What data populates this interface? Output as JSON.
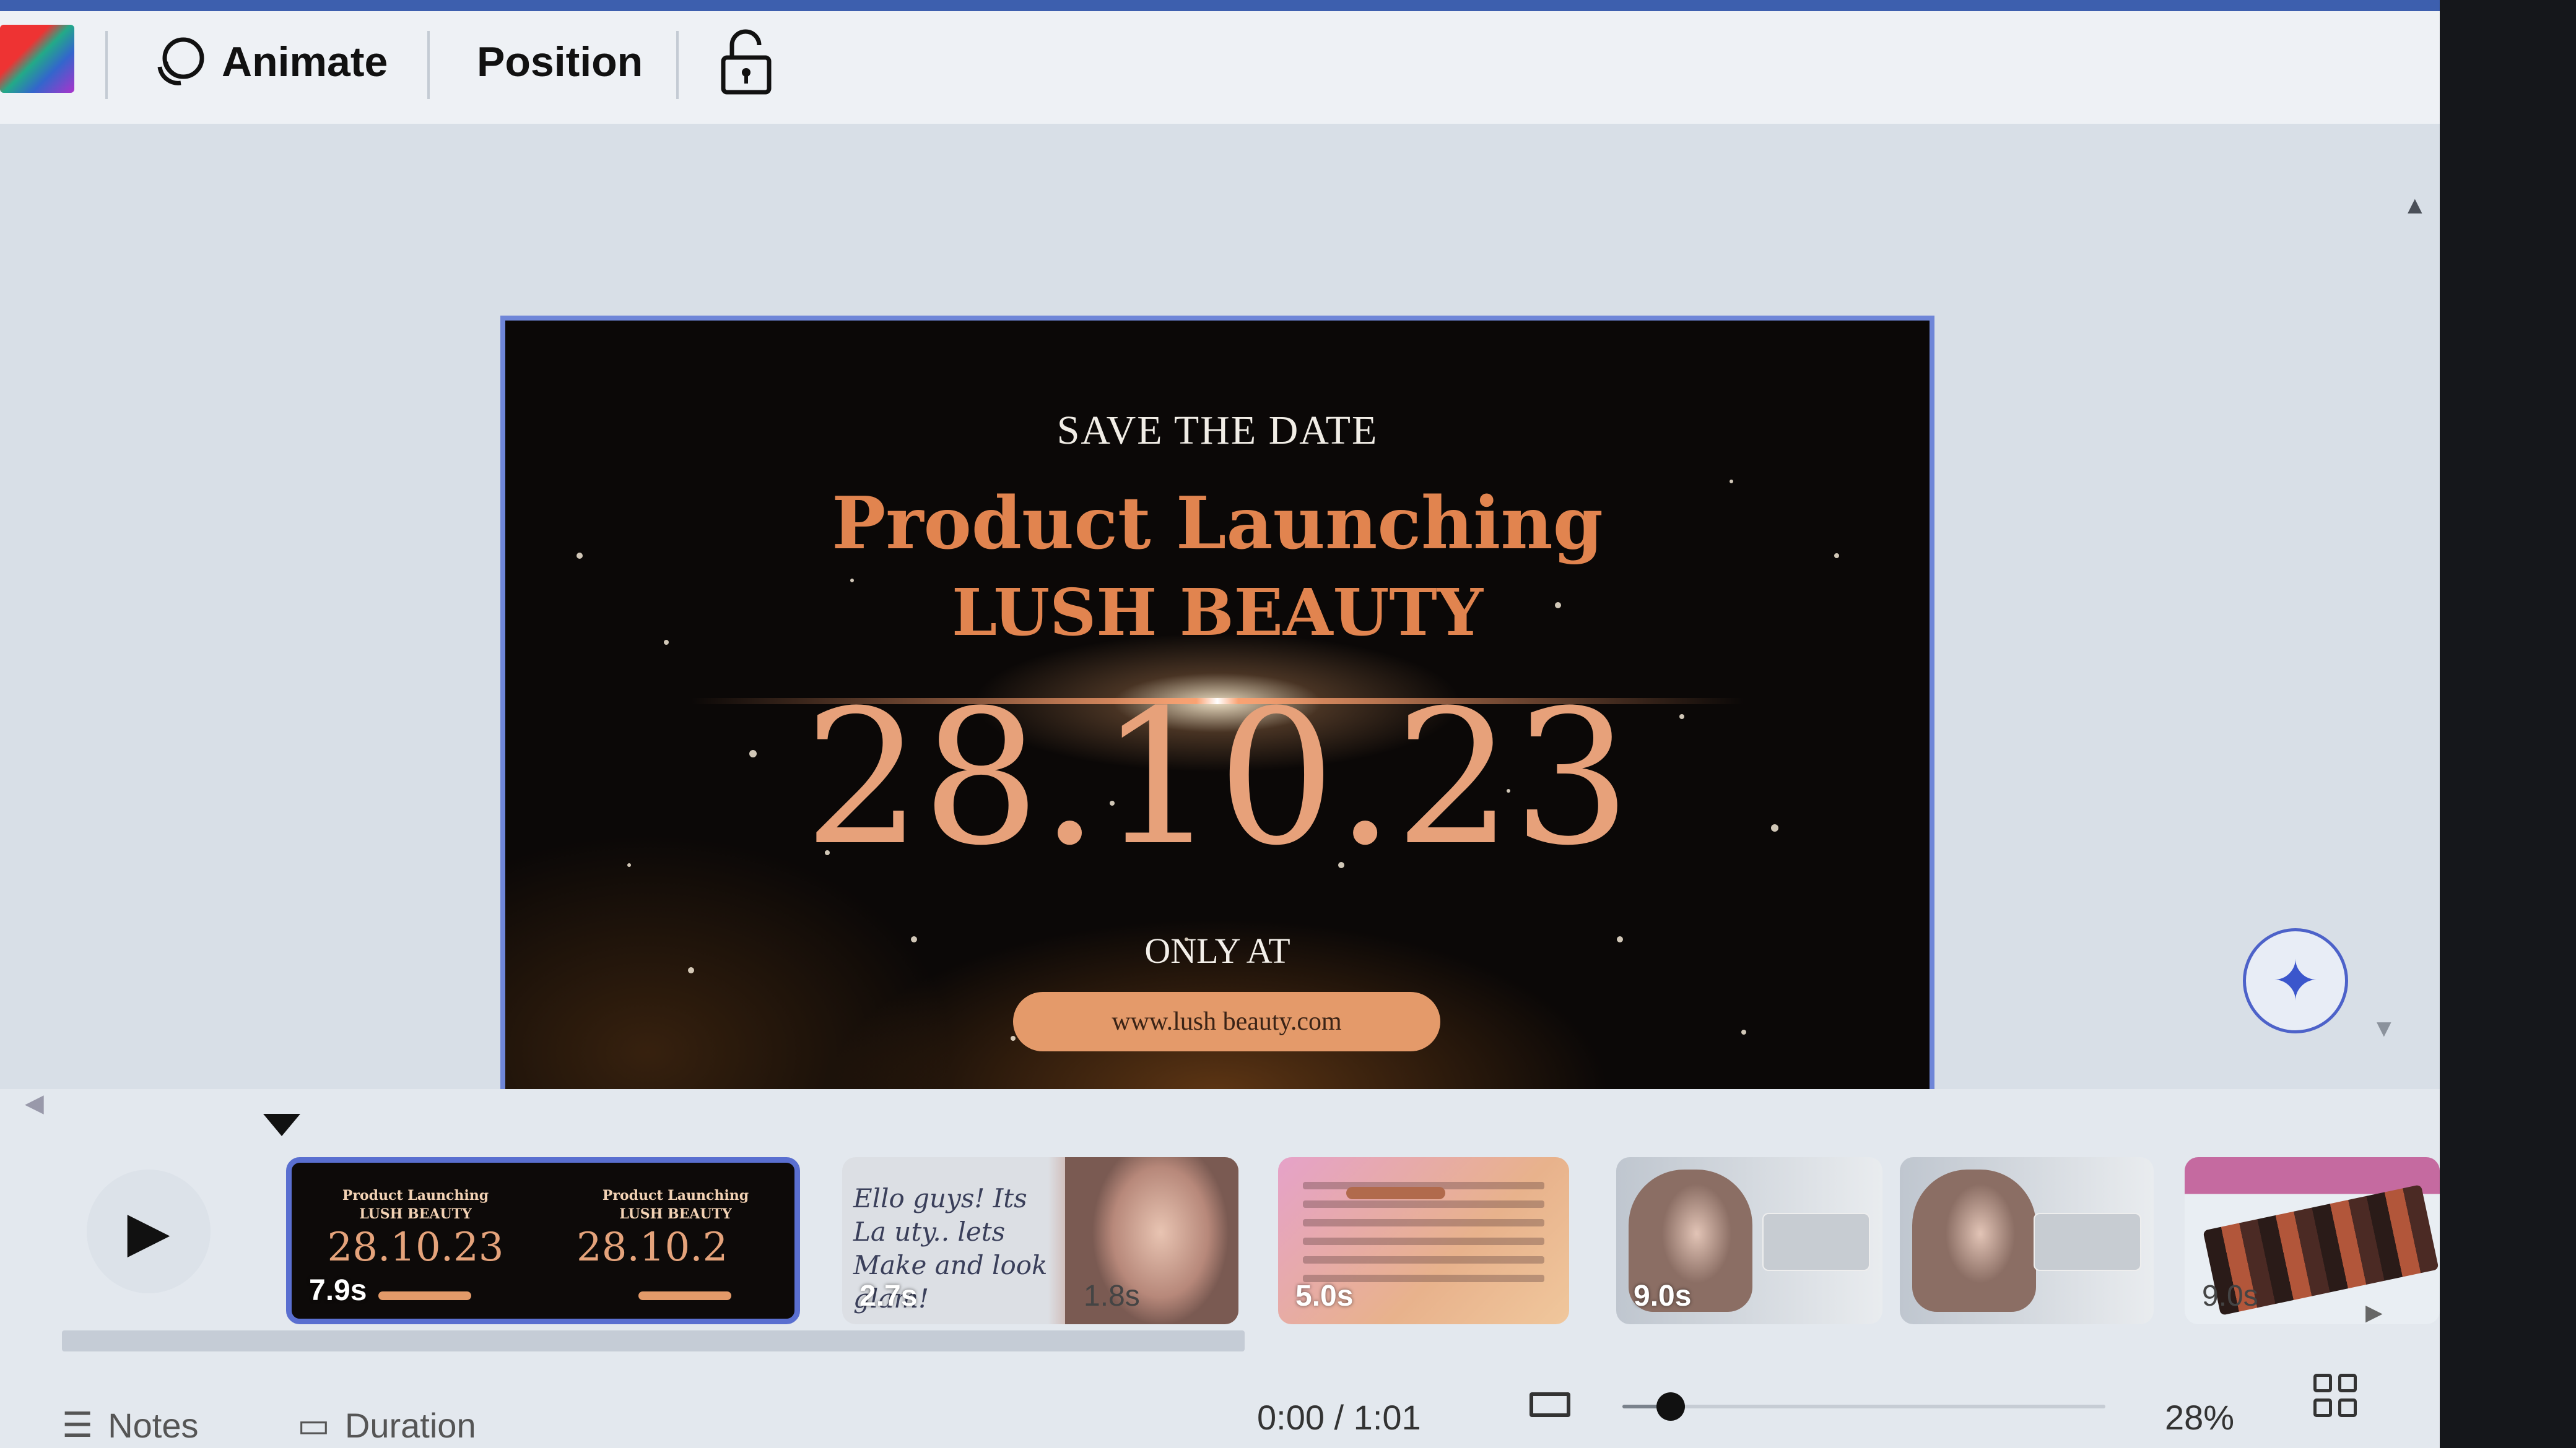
{
  "toolbar": {
    "animate_label": "Animate",
    "position_label": "Position"
  },
  "slide": {
    "save_the_date": "SAVE THE DATE",
    "title_line1": "Product Launching",
    "title_line2": "LUSH BEAUTY",
    "date": "28.10.23",
    "only_at": "ONLY AT",
    "url": "www.lush beauty.com"
  },
  "timeline": {
    "thumbnails": [
      {
        "duration": "7.9s",
        "mini_title1": "Product Launching",
        "mini_title2": "LUSH BEAUTY",
        "mini_date": "28.10.23",
        "mini_date_cut": "28.10.2"
      },
      {
        "duration": "2.7s",
        "script_text": "Ello guys! Its La uty.. lets Make and look glam!"
      },
      {
        "duration": "1.8s"
      },
      {
        "duration": "5.0s"
      },
      {
        "duration": "9.0s"
      },
      {
        "duration": ""
      },
      {
        "duration": "9.0s"
      }
    ]
  },
  "bottombar": {
    "notes_label": "Notes",
    "duration_label": "Duration",
    "time": "0:00 / 1:01",
    "zoom": "28%",
    "zoom_fraction": 0.1
  },
  "colors": {
    "accent": "#5a6fd0",
    "title_orange": "#e1844f",
    "pill": "#e49a6a"
  },
  "icons": [
    "color-swatch-icon",
    "animate-icon",
    "lock-open-icon",
    "sparkle-icon",
    "play-icon",
    "aspect-ratio-icon",
    "grid-view-icon",
    "notes-icon",
    "duration-icon"
  ]
}
